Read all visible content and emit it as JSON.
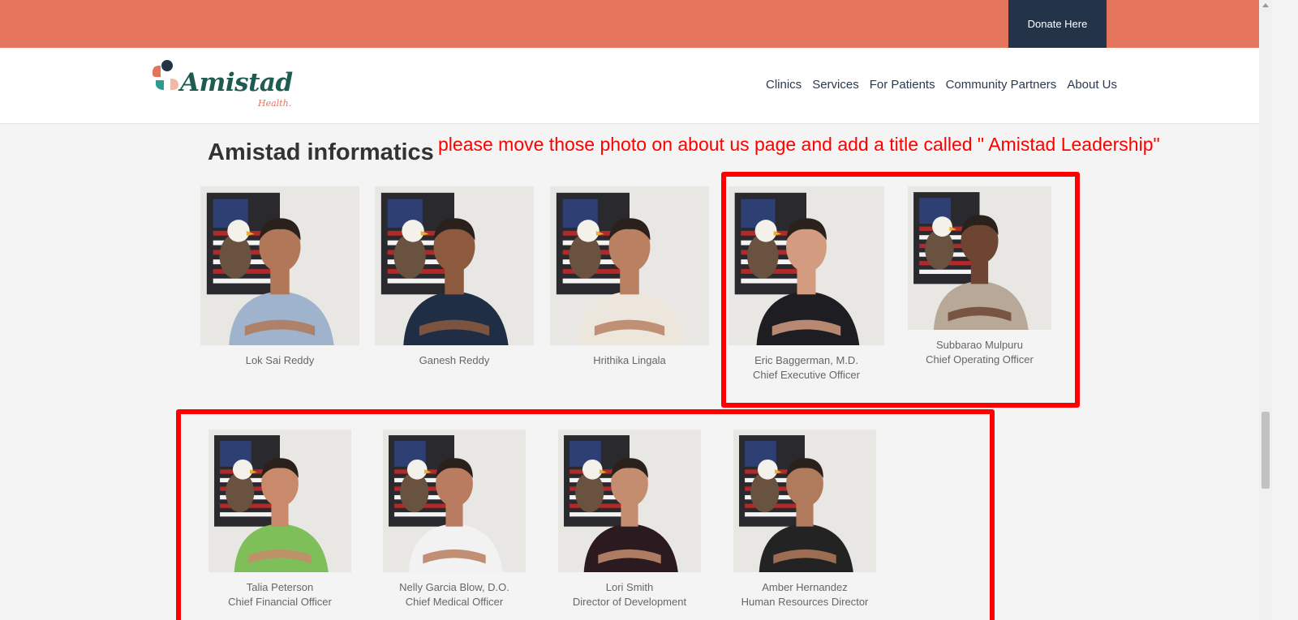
{
  "topbar": {
    "donate_label": "Donate Here"
  },
  "logo": {
    "word": "Amistad",
    "sub": "Health."
  },
  "nav": [
    "Clinics",
    "Services",
    "For Patients",
    "Community Partners",
    "About Us"
  ],
  "section": {
    "title": "Amistad informatics"
  },
  "annotation": "please move those photo on about us page and add a title called \" Amistad Leadership\"",
  "people_row1": [
    {
      "name": "Lok Sai Reddy",
      "role": "",
      "shirt": "#9fb3cc",
      "skin": "#b07858"
    },
    {
      "name": "Ganesh Reddy",
      "role": "",
      "shirt": "#1f2d45",
      "skin": "#8d5a3d"
    },
    {
      "name": "Hrithika Lingala",
      "role": "",
      "shirt": "#ece6dc",
      "skin": "#b98062"
    },
    {
      "name": "Eric Baggerman, M.D.",
      "role": "Chief Executive Officer",
      "shirt": "#1d1d22",
      "skin": "#d39c80"
    },
    {
      "name": "Subbarao Mulpuru",
      "role": "Chief Operating Officer",
      "shirt": "#b8a898",
      "skin": "#6e4532"
    }
  ],
  "people_row2": [
    {
      "name": "Talia Peterson",
      "role": "Chief Financial Officer",
      "shirt": "#7fbf5a",
      "skin": "#c98a6c"
    },
    {
      "name": "Nelly Garcia Blow, D.O.",
      "role": "Chief Medical Officer",
      "shirt": "#f2f2f2",
      "skin": "#b97c60"
    },
    {
      "name": "Lori Smith",
      "role": "Director of Development",
      "shirt": "#2b1a1f",
      "skin": "#c58d70"
    },
    {
      "name": "Amber Hernandez",
      "role": "Human Resources Director",
      "shirt": "#232323",
      "skin": "#b07a5c"
    }
  ]
}
